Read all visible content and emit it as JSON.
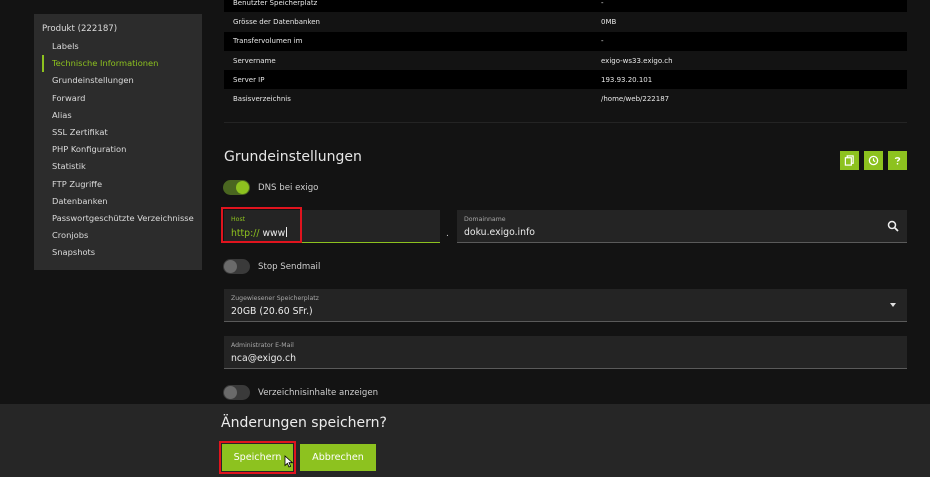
{
  "sidebar": {
    "title": "Produkt (222187)",
    "items": [
      {
        "label": "Labels",
        "active": false
      },
      {
        "label": "Technische Informationen",
        "active": true
      },
      {
        "label": "Grundeinstellungen",
        "active": false
      },
      {
        "label": "Forward",
        "active": false
      },
      {
        "label": "Alias",
        "active": false
      },
      {
        "label": "SSL Zertifikat",
        "active": false
      },
      {
        "label": "PHP Konfiguration",
        "active": false
      },
      {
        "label": "Statistik",
        "active": false
      },
      {
        "label": "FTP Zugriffe",
        "active": false
      },
      {
        "label": "Datenbanken",
        "active": false
      },
      {
        "label": "Passwortgeschützte Verzeichnisse",
        "active": false
      },
      {
        "label": "Cronjobs",
        "active": false
      },
      {
        "label": "Snapshots",
        "active": false
      }
    ]
  },
  "info_table": {
    "rows": [
      {
        "key": "Benutzter Speicherplatz",
        "value": "-"
      },
      {
        "key": "Grösse der Datenbanken",
        "value": "0MB"
      },
      {
        "key": "Transfervolumen im",
        "value": "-"
      },
      {
        "key": "Servername",
        "value": "exigo-ws33.exigo.ch"
      },
      {
        "key": "Server IP",
        "value": "193.93.20.101"
      },
      {
        "key": "Basisverzeichnis",
        "value": "/home/web/222187"
      }
    ]
  },
  "section": {
    "title": "Grundeinstellungen",
    "actions": [
      "copy-icon",
      "history-icon",
      "help-icon"
    ]
  },
  "dns_toggle": {
    "label": "DNS bei exigo",
    "on": true
  },
  "host_field": {
    "label": "Host",
    "prefix": "http://",
    "value": "www"
  },
  "separator": ".",
  "domain_field": {
    "label": "Domainname",
    "value": "doku.exigo.info"
  },
  "sendmail_toggle": {
    "label": "Stop Sendmail",
    "on": false
  },
  "space_field": {
    "label": "Zugewiesener Speicherplatz",
    "value": "20GB (20.60 SFr.)"
  },
  "email_field": {
    "label": "Administrator E-Mail",
    "value": "nca@exigo.ch"
  },
  "dir_toggle": {
    "label": "Verzeichnisinhalte anzeigen",
    "on": false
  },
  "save_bar": {
    "question": "Änderungen speichern?",
    "save_label": "Speichern",
    "cancel_label": "Abbrechen"
  },
  "colors": {
    "accent": "#8dc21f",
    "highlight": "#e0141e",
    "background": "#131313"
  }
}
